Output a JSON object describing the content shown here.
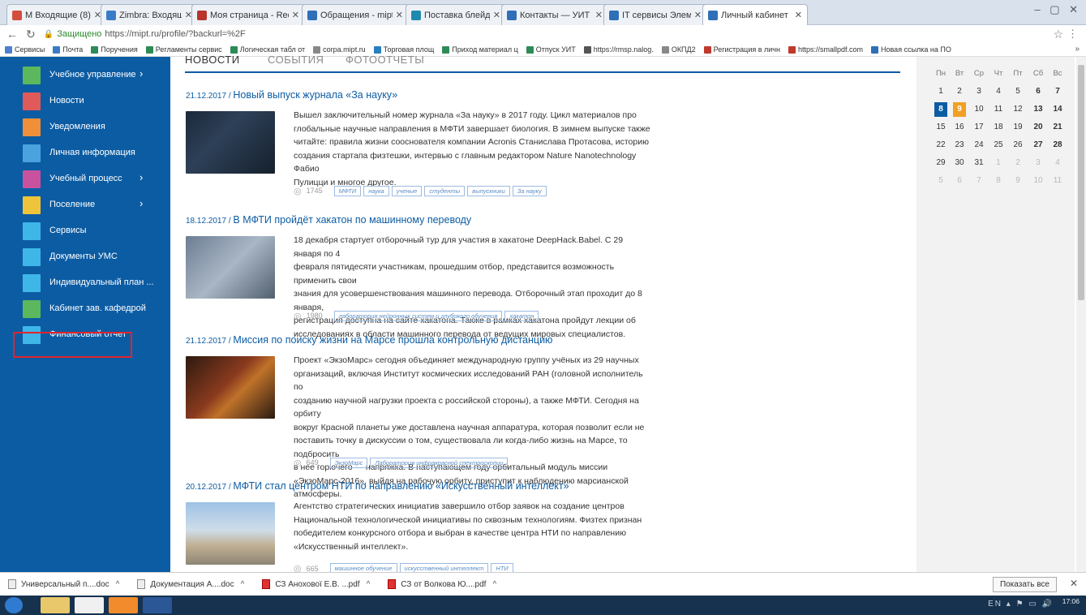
{
  "browser": {
    "tabs": [
      {
        "label": "M Входящие (8) - surkova.",
        "color": "#d24d3e"
      },
      {
        "label": "Zimbra: Входящие (11)",
        "color": "#3a7bc8"
      },
      {
        "label": "Моя страница - Redmin",
        "color": "#b8342d"
      },
      {
        "label": "Обращения - mipt.ru",
        "color": "#2e6fb8"
      },
      {
        "label": "Поставка блейд центр",
        "color": "#1f8ab0"
      },
      {
        "label": "Контакты — УИТ",
        "color": "#2e6fb8"
      },
      {
        "label": "IT сервисы Элементы -",
        "color": "#2e6fb8"
      },
      {
        "label": "Личный кабинет",
        "color": "#2e6fb8"
      }
    ],
    "secure_label": "Защищено",
    "url": "https://mipt.ru/profile/?backurl=%2F",
    "bookmarks": [
      {
        "label": "Сервисы",
        "color": "#4d7fd1"
      },
      {
        "label": "Почта",
        "color": "#3a7bc8"
      },
      {
        "label": "Поручения",
        "color": "#2e8b57"
      },
      {
        "label": "Регламенты сервис",
        "color": "#2e8b57"
      },
      {
        "label": "Логическая табл от",
        "color": "#2e8b57"
      },
      {
        "label": "corpa.mipt.ru",
        "color": "#888888"
      },
      {
        "label": "Торговая площ",
        "color": "#2a7fbf"
      },
      {
        "label": "Приход материал ц",
        "color": "#2e8b57"
      },
      {
        "label": "Отпуск УИТ",
        "color": "#2e8b57"
      },
      {
        "label": "https://rmsp.nalog.",
        "color": "#555555"
      },
      {
        "label": "ОКПД2",
        "color": "#888888"
      },
      {
        "label": "Регистрация в личн",
        "color": "#c0392b"
      },
      {
        "label": "https://smallpdf.com",
        "color": "#c0392b"
      },
      {
        "label": "Новая ссылка на ПО",
        "color": "#2e6fb8"
      }
    ]
  },
  "sidebar": {
    "items": [
      {
        "label": "Учебное управление",
        "color": "#5cb85c",
        "arrow": "›"
      },
      {
        "label": "Новости",
        "color": "#e05a5a",
        "arrow": ""
      },
      {
        "label": "Уведомления",
        "color": "#ef8f3a",
        "arrow": ""
      },
      {
        "label": "Личная информация",
        "color": "#4aa3df",
        "arrow": ""
      },
      {
        "label": "Учебный процесс",
        "color": "#c9529f",
        "arrow": "›"
      },
      {
        "label": "Поселение",
        "color": "#f0c43a",
        "arrow": "›"
      },
      {
        "label": "Сервисы",
        "color": "#3fb6e8",
        "arrow": ""
      },
      {
        "label": "Документы УМС",
        "color": "#3fb6e8",
        "arrow": ""
      },
      {
        "label": "Индивидуальный план ...",
        "color": "#3fb6e8",
        "arrow": ""
      },
      {
        "label": "Кабинет зав. кафедрой",
        "color": "#5cb85c",
        "arrow": ""
      },
      {
        "label": "Финансовый отчет",
        "color": "#3fb6e8",
        "arrow": ""
      }
    ]
  },
  "news_tabs": [
    "НОВОСТИ",
    "СОБЫТИЯ",
    "ФОТООТЧЕТЫ"
  ],
  "articles": [
    {
      "date": "21.12.2017",
      "title": "Новый выпуск журнала «За науку»",
      "lines": [
        "Вышел заключительный номер журнала «За науку» в 2017 году. Цикл материалов про",
        "глобальные научные направления в МФТИ завершает биология. В зимнем выпуске также",
        "читайте: правила жизни сооснователя компании Acronis Станислава Протасова, историю",
        "создания стартапа физтешки, интервью с главным редактором Nature Nanotechnology Фабио",
        "Пулицци и многое другое."
      ],
      "views": "1745",
      "tags": [
        "МФТИ",
        "наука",
        "ученые",
        "студенты",
        "выпускники",
        "За науку"
      ]
    },
    {
      "date": "18.12.2017",
      "title": "В МФТИ пройдёт хакатон по машинному переводу",
      "lines": [
        "18 декабря стартует отборочный тур для участия в хакатоне DeepHack.Babel. С 29 января по 4",
        "февраля пятидесяти участникам, прошедшим отбор, представится возможность применить свои",
        "знания для усовершенствования машинного перевода. Отборочный этап проходит до 8 января,",
        "регистрация доступна на сайте хакатона. Также в рамках хакатона пройдут лекции об",
        "исследованиях в области машинного перевода от ведущих мировых специалистов."
      ],
      "views": "1980",
      "tags": [
        "лаборатория нейронных систем и глубокого обучения",
        "хакатон"
      ]
    },
    {
      "date": "21.12.2017",
      "title": "Миссия по поиску жизни на Марсе прошла контрольную дистанцию",
      "lines": [
        "Проект «ЭкзоМарс» сегодня объединяет международную группу учёных из 29 научных",
        "организаций, включая Институт космических исследований РАН (головной исполнитель по",
        "созданию научной нагрузки проекта с российской стороны), а также МФТИ. Сегодня на орбиту",
        "вокруг Красной планеты уже доставлена научная аппаратура, которая позволит если не",
        "поставить точку в дискуссии о том, существовала ли когда-либо жизнь на Марсе, то подбросить",
        "в нее горючего — напряжка. В наступающем году орбитальный модуль миссии",
        "«ЭкзоМарс-2016», выйдя на рабочую орбиту, приступит к наблюдению марсианской атмосферы."
      ],
      "views": "649",
      "tags": [
        "ЭкзоМарс",
        "Лаборатория инфракрасной спектроскопии"
      ]
    },
    {
      "date": "20.12.2017",
      "title": "МФТИ стал центром НТИ по направлению «Искусственный интеллект»",
      "lines": [
        "Агентство стратегических инициатив завершило отбор заявок на создание центров",
        "Национальной технологической инициативы по сквозным технологиям. Физтех признан",
        "победителем конкурсного отбора и выбран в качестве центра НТИ по направлению",
        "«Искусственный интеллект»."
      ],
      "views": "665",
      "tags": [
        "машинное обучение",
        "искусственный интеллект",
        "НТИ"
      ]
    }
  ],
  "calendar": {
    "weekdays": [
      "Пн",
      "Вт",
      "Ср",
      "Чт",
      "Пт",
      "Сб",
      "Вс"
    ],
    "weeks": [
      [
        "1",
        "2",
        "3",
        "4",
        "5",
        "6",
        "7"
      ],
      [
        "8",
        "9",
        "10",
        "11",
        "12",
        "13",
        "14"
      ],
      [
        "15",
        "16",
        "17",
        "18",
        "19",
        "20",
        "21"
      ],
      [
        "22",
        "23",
        "24",
        "25",
        "26",
        "27",
        "28"
      ],
      [
        "29",
        "30",
        "31",
        "1",
        "2",
        "3",
        "4"
      ],
      [
        "5",
        "6",
        "7",
        "8",
        "9",
        "10",
        "11"
      ]
    ],
    "today": "8",
    "selected": "9",
    "today_color": "#0c5ca3",
    "selected_color": "#f0a023"
  },
  "downloads": {
    "items": [
      "Универсальный п....doc",
      "Документация А....doc",
      "СЗ Анохової Е.В. ...pdf",
      "СЗ от Волкова Ю....pdf"
    ],
    "show_all": "Показать все"
  },
  "taskbar": {
    "lang": "EN",
    "time": "17:06"
  }
}
